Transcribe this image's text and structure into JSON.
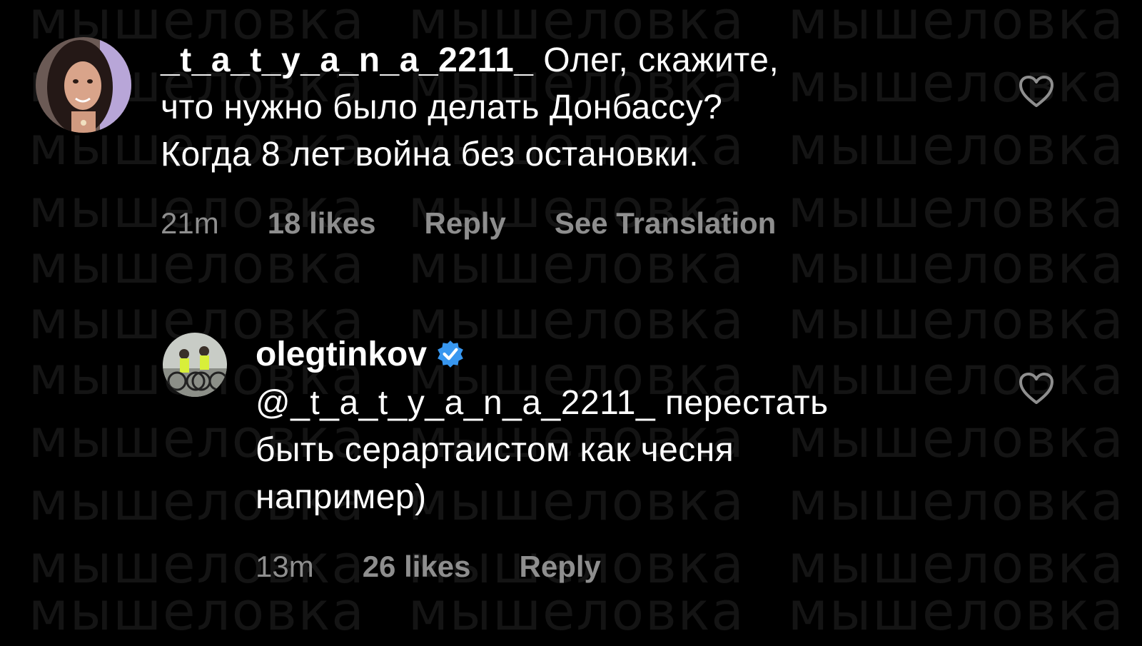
{
  "watermark": {
    "text": "мышеловка"
  },
  "comments": [
    {
      "username": "_t_a_t_y_a_n_a_2211_",
      "text_line1": " Олег, скажите,",
      "text_line2": "что нужно было делать Донбассу?",
      "text_line3": "Когда 8 лет война без остановки.",
      "time": "21m",
      "likes": "18 likes",
      "reply_label": "Reply",
      "translation_label": "See Translation"
    }
  ],
  "reply": {
    "username": "olegtinkov",
    "verified": true,
    "mention": "@_t_a_t_y_a_n_a_2211_",
    "text_line1": " перестать",
    "text_line2": "быть серартаистом как чесня",
    "text_line3": "например)",
    "time": "13m",
    "likes": "26 likes",
    "reply_label": "Reply"
  },
  "colors": {
    "background": "#000000",
    "text": "#ffffff",
    "meta": "#8e8e8e",
    "verified": "#3897f0"
  }
}
